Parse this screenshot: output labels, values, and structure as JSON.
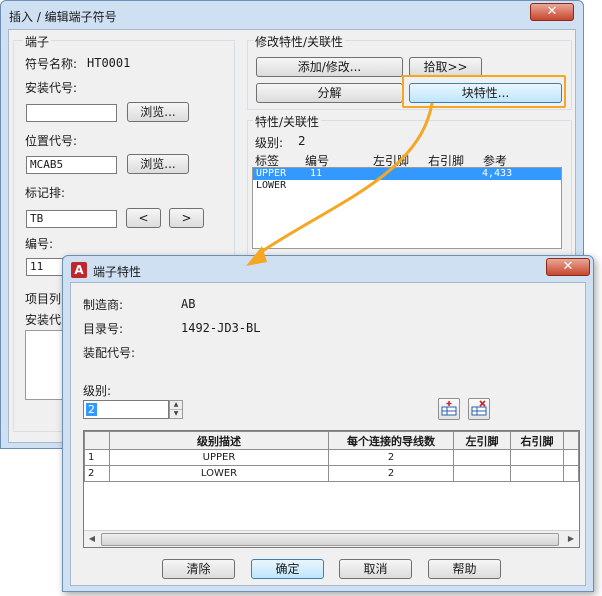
{
  "back_dialog": {
    "title": "插入 / 编辑端子符号",
    "close_glyph": "✕",
    "terminal_group": {
      "label": "端子",
      "symbol_name_label": "符号名称:",
      "symbol_name_value": "HT0001",
      "install_code_label": "安装代号:",
      "install_code_value": "",
      "browse_label": "浏览...",
      "location_code_label": "位置代号:",
      "location_code_value": "MCAB5",
      "tag_strip_label": "标记排:",
      "tag_strip_value": "TB",
      "prev_glyph": "<",
      "next_glyph": ">",
      "number_label": "编号:",
      "number_value": "11",
      "item_list_label": "项目列",
      "install_label_partial": "安装代"
    },
    "modify_group": {
      "label": "修改特性/关联性",
      "add_modify_label": "添加/修改...",
      "pick_label": "拾取>>",
      "explode_label": "分解",
      "block_props_label": "块特性..."
    },
    "props_group": {
      "label": "特性/关联性",
      "level_label": "级别:",
      "level_value": "2",
      "columns": [
        "标签",
        "编号",
        "左引脚",
        "右引脚",
        "参考"
      ],
      "rows": [
        {
          "tag": "UPPER",
          "number": "11",
          "left": "",
          "right": "",
          "ref": "4,433"
        },
        {
          "tag": "LOWER",
          "number": "",
          "left": "",
          "right": "",
          "ref": ""
        }
      ]
    }
  },
  "front_dialog": {
    "title": "端子特性",
    "app_icon": "A",
    "close_glyph": "✕",
    "manufacturer_label": "制造商:",
    "manufacturer_value": "AB",
    "catalog_label": "目录号:",
    "catalog_value": "1492-JD3-BL",
    "assembly_label": "装配代号:",
    "assembly_value": "",
    "level_label": "级别:",
    "level_value": "2",
    "grid": {
      "columns": [
        "",
        "级别描述",
        "每个连接的导线数",
        "左引脚",
        "右引脚"
      ],
      "rows": [
        {
          "index": "1",
          "desc": "UPPER",
          "wires": "2",
          "left": "",
          "right": ""
        },
        {
          "index": "2",
          "desc": "LOWER",
          "wires": "2",
          "left": "",
          "right": ""
        }
      ]
    },
    "buttons": {
      "clear": "清除",
      "ok": "确定",
      "cancel": "取消",
      "help": "帮助"
    }
  },
  "colors": {
    "highlight": "#f5a623",
    "selection": "#3399ff",
    "close_red": "#c7462d"
  }
}
